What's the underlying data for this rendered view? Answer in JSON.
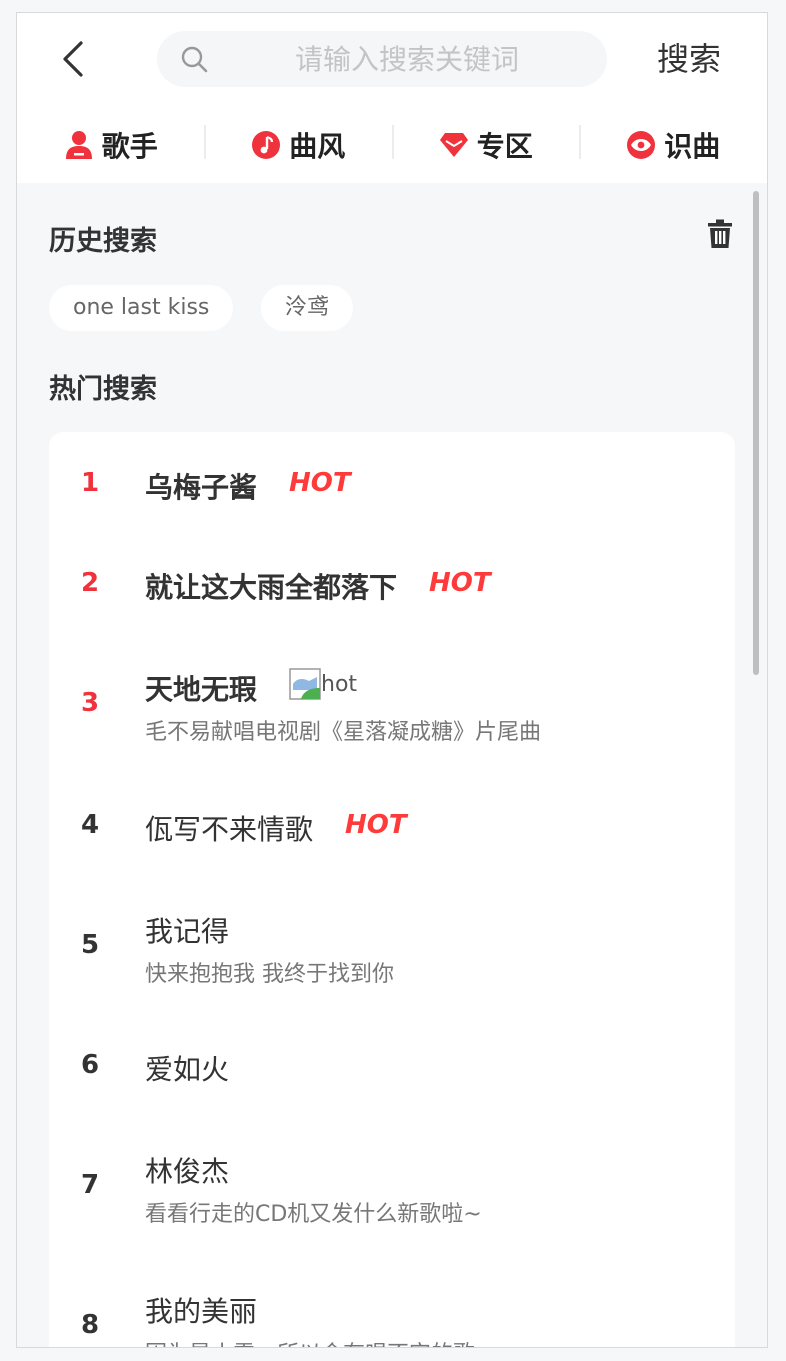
{
  "header": {
    "search_placeholder": "请输入搜索关键词",
    "search_button": "搜索"
  },
  "categories": [
    {
      "label": "歌手",
      "icon": "singer-icon"
    },
    {
      "label": "曲风",
      "icon": "music-note-icon"
    },
    {
      "label": "专区",
      "icon": "diamond-icon"
    },
    {
      "label": "识曲",
      "icon": "eye-icon"
    }
  ],
  "history": {
    "title": "历史搜索",
    "items": [
      "one last kiss",
      "泠鸢"
    ]
  },
  "hot": {
    "title": "热门搜索",
    "hot_label": "HOT",
    "broken_image_alt": "hot",
    "items": [
      {
        "rank": "1",
        "title": "乌梅子酱",
        "desc": ""
      },
      {
        "rank": "2",
        "title": "就让这大雨全都落下",
        "desc": ""
      },
      {
        "rank": "3",
        "title": "天地无瑕",
        "desc": "毛不易献唱电视剧《星落凝成糖》片尾曲"
      },
      {
        "rank": "4",
        "title": "佤写不来情歌",
        "desc": ""
      },
      {
        "rank": "5",
        "title": "我记得",
        "desc": "快来抱抱我 我终于找到你"
      },
      {
        "rank": "6",
        "title": "爱如火",
        "desc": ""
      },
      {
        "rank": "7",
        "title": "林俊杰",
        "desc": "看看行走的CD机又发什么新歌啦~"
      },
      {
        "rank": "8",
        "title": "我的美丽",
        "desc": "因为是小雪，所以会有唱不完的歌"
      }
    ]
  },
  "colors": {
    "accent": "#ff3a3a",
    "rank_top": "#f0323c",
    "rank_normal": "#333333"
  }
}
